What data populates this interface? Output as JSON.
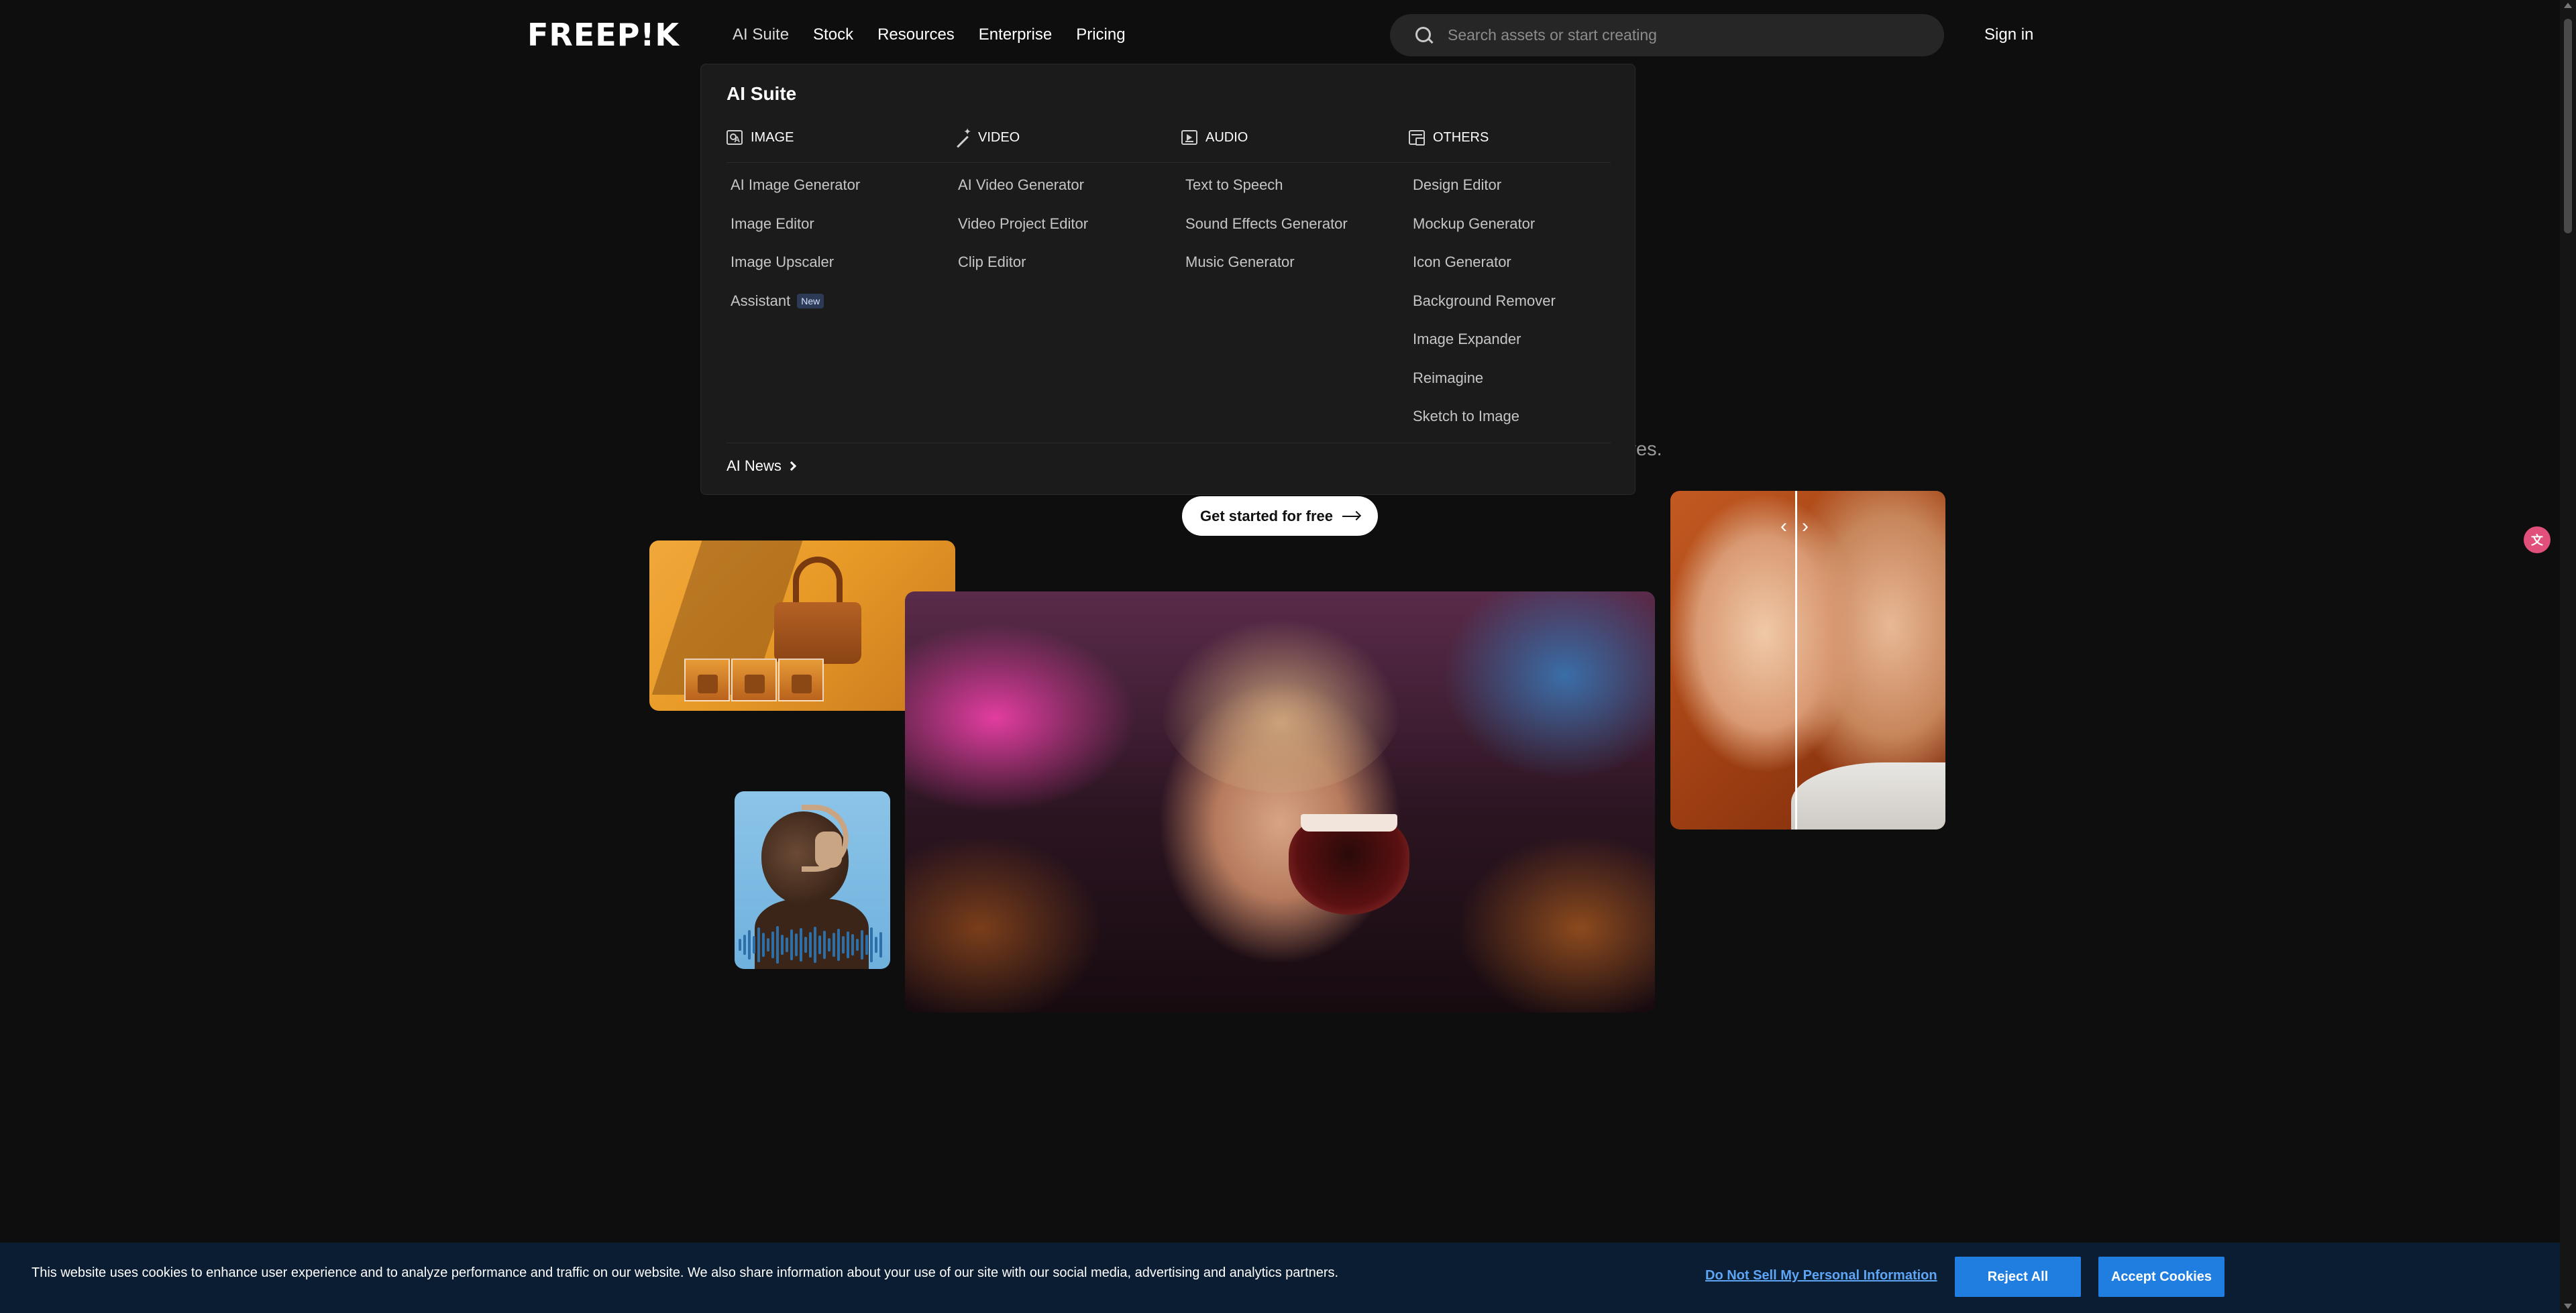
{
  "header": {
    "logo_text": "FREEP!K",
    "nav": [
      "AI Suite",
      "Stock",
      "Resources",
      "Enterprise",
      "Pricing"
    ],
    "search_placeholder": "Search assets or start creating",
    "sign_in": "Sign in"
  },
  "dropdown": {
    "title": "AI Suite",
    "columns": [
      {
        "heading": "IMAGE",
        "icon": "image-icon",
        "links": [
          "AI Image Generator",
          "Image Editor",
          "Image Upscaler",
          "Assistant"
        ]
      },
      {
        "heading": "VIDEO",
        "icon": "magic-wand-icon",
        "links": [
          "AI Video Generator",
          "Video Project Editor",
          "Clip Editor"
        ]
      },
      {
        "heading": "AUDIO",
        "icon": "audio-icon",
        "links": [
          "Text to Speech",
          "Sound Effects Generator",
          "Music Generator"
        ]
      },
      {
        "heading": "OTHERS",
        "icon": "apps-icon",
        "links": [
          "Design Editor",
          "Mockup Generator",
          "Icon Generator",
          "Background Remover",
          "Image Expander",
          "Reimagine",
          "Sketch to Image"
        ]
      }
    ],
    "assistant_badge": "New",
    "news_label": "AI News"
  },
  "hero": {
    "subtitle_fragment": "ives.",
    "cta_label": "Get started for free"
  },
  "cookie_banner": {
    "text": "This website uses cookies to enhance user experience and to analyze performance and traffic on our website. We also share information about your use of our site with our social media, advertising and analytics partners.",
    "do_not_sell": "Do Not Sell My Personal Information",
    "reject": "Reject All",
    "accept": "Accept Cookies"
  },
  "colors": {
    "background": "#0e0e0e",
    "dropdown_bg": "#1b1b1b",
    "cookie_bg": "#0b1d33",
    "cookie_button": "#1f7ee0",
    "cookie_link": "#5da5f5"
  }
}
